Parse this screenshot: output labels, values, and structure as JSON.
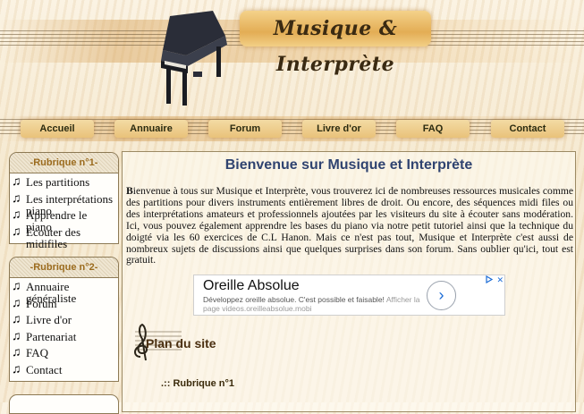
{
  "header": {
    "site_title": "Musique & Interprète"
  },
  "nav": [
    {
      "label": "Accueil"
    },
    {
      "label": "Annuaire"
    },
    {
      "label": "Forum"
    },
    {
      "label": "Livre d'or"
    },
    {
      "label": "FAQ"
    },
    {
      "label": "Contact"
    }
  ],
  "sidebar": {
    "rubrique1": {
      "title": "-Rubrique n°1-",
      "items": [
        "Les partitions",
        "Les interprétations piano",
        "Apprendre le piano",
        "Ecouter des midifiles"
      ]
    },
    "rubrique2": {
      "title": "-Rubrique n°2-",
      "items": [
        "Annuaire généraliste",
        "Forum",
        "Livre d'or",
        "Partenariat",
        "FAQ",
        "Contact"
      ]
    }
  },
  "main": {
    "heading": "Bienvenue sur Musique et Interprète",
    "intro_first": "B",
    "intro_rest": "ienvenue à tous sur Musique et Interprète, vous trouverez ici de nombreuses ressources musicales comme des partitions pour divers instruments entièrement libres de droit. Ou encore, des séquences midi files ou des interprétations amateurs et professionnels ajoutées par les visiteurs du site à écouter sans modération. Ici, vous pouvez également apprendre les bases du piano via notre petit tutoriel ainsi que la technique du doigté via les 60 exercices de C.L Hanon. Mais ce n'est pas tout, Musique et Interprète c'est aussi de nombreux sujets de discussions ainsi que quelques surprises dans son forum. Sans oublier qu'ici, tout est gratuit.",
    "ad": {
      "title": "Oreille Absolue",
      "description": "Développez oreille absolue. C'est possible et faisable!",
      "link_label": "Afficher la page videos.oreilleabsolue.mobi",
      "arrow": "›"
    },
    "plan_title": "Plan du site",
    "plan_sub": ".:: Rubrique n°1"
  },
  "icons": {
    "note": "♫",
    "clef": "𝄞"
  },
  "colors": {
    "heading": "#2f4370",
    "box_title": "#9b6b1e",
    "nav_bg": "#e9c27a"
  }
}
